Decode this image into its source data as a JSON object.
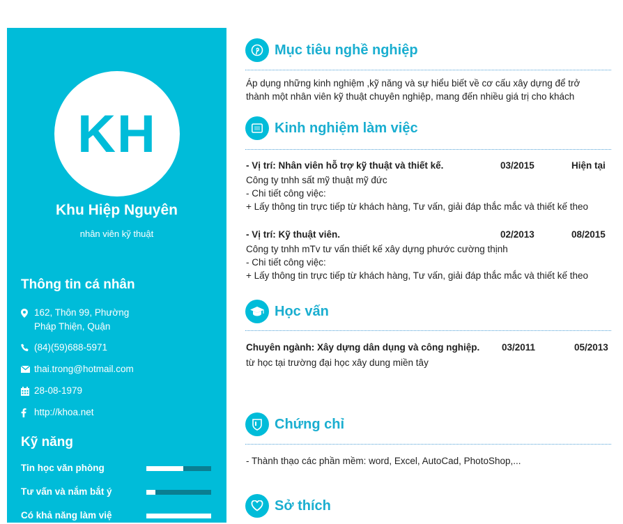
{
  "profile": {
    "initials": "KH",
    "name": "Khu Hiệp Nguyên",
    "title": "nhân viên kỹ thuật"
  },
  "personal": {
    "heading": "Thông tin cá nhân",
    "address_line1": "162, Thôn 99, Phường",
    "address_line2": "Pháp Thiện, Quận",
    "phone": "(84)(59)688-5971",
    "email": "thai.trong@hotmail.com",
    "birthday": "28-08-1979",
    "website": "http://khoa.net",
    "icons": [
      "map-marker-icon",
      "phone-icon",
      "envelope-icon",
      "calendar-icon",
      "facebook-icon"
    ]
  },
  "skills": {
    "heading": "Kỹ năng",
    "items": [
      {
        "label": "Tin học văn phòng",
        "level": 0.57
      },
      {
        "label": "Tư vấn và nắm bắt ý",
        "level": 0.14
      },
      {
        "label": "Có khả năng làm việ",
        "level": 1.0
      }
    ]
  },
  "objective": {
    "title": "Mục tiêu nghề nghiệp",
    "line1": "Áp dụng những kinh nghiệm ,kỹ năng và sự hiểu biết về cơ cấu xây dựng để trở",
    "line2": "thành một nhân viên kỹ thuật chuyên nghiệp, mang đến nhiều giá trị cho khách"
  },
  "experience": {
    "title": "Kinh nghiệm làm việc",
    "jobs": [
      {
        "position": "- Vị trí: Nhân viên hỗ trợ kỹ thuật và thiết kế.",
        "start": "03/2015",
        "end": "Hiện tại",
        "company": "Công ty tnhh sất mỹ thuật mỹ đức",
        "detail_label": "- Chi tiết công việc:",
        "detail": "+ Lấy thông tin trực tiếp từ khách hàng, Tư vấn, giải đáp thắc mắc và thiết kế theo"
      },
      {
        "position": "- Vị trí: Kỹ thuật viên.",
        "start": "02/2013",
        "end": "08/2015",
        "company": "Công ty tnhh mTv tư vấn thiết kế xây dựng phước cường thịnh",
        "detail_label": "- Chi tiết công việc:",
        "detail": "+ Lấy thông tin trực tiếp từ khách hàng, Tư vấn, giải đáp thắc mắc và thiết kế theo"
      }
    ]
  },
  "education": {
    "title": "Học vấn",
    "major": "Chuyên ngành: Xây dựng dân dụng và công nghiệp.",
    "start": "03/2011",
    "end": "05/2013",
    "school": "từ học tại trường đại học xây dung miền tây"
  },
  "certificates": {
    "title": "Chứng chỉ",
    "line": "- Thành thạo các phần mềm: word, Excel, AutoCad, PhotoShop,..."
  },
  "hobbies": {
    "title": "Sở thích"
  },
  "colors": {
    "accent": "#00bcd9",
    "heading_text": "#1aaed0",
    "skill_track": "#0a7e92"
  }
}
